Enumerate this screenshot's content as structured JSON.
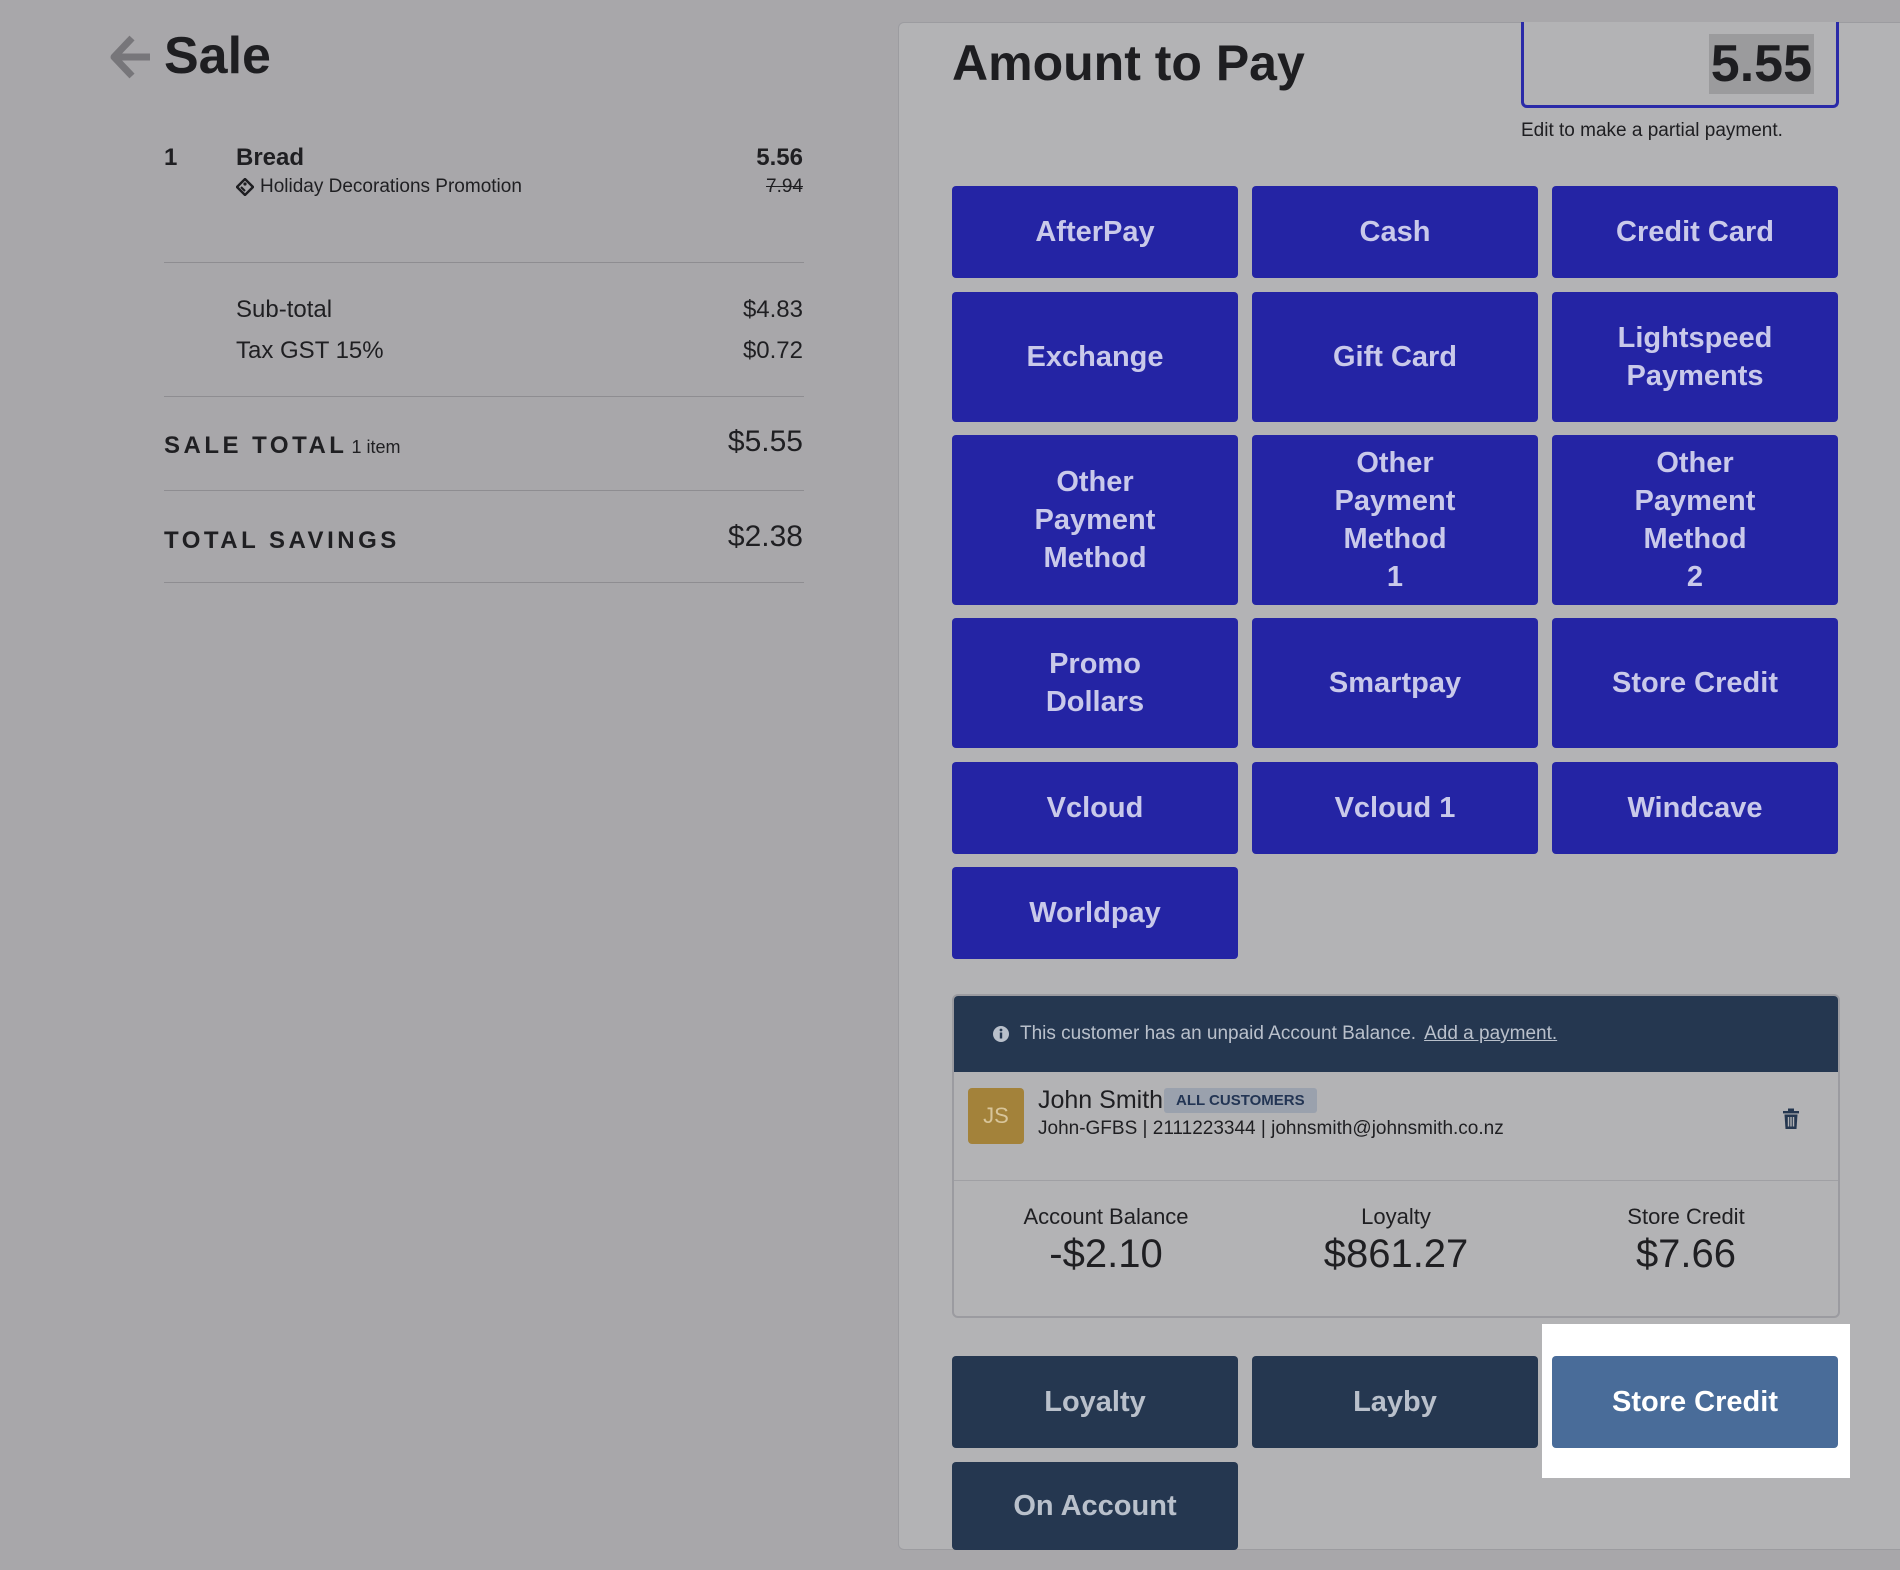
{
  "sale": {
    "title": "Sale",
    "item": {
      "qty": "1",
      "name": "Bread",
      "promo": "Holiday Decorations Promotion",
      "price": "5.56",
      "original_price": "7.94"
    },
    "subtotal_label": "Sub-total",
    "subtotal_value": "$4.83",
    "tax_label": "Tax GST 15%",
    "tax_value": "$0.72",
    "total_label": "SALE TOTAL",
    "total_items": "1 item",
    "total_value": "$5.55",
    "savings_label": "TOTAL SAVINGS",
    "savings_value": "$2.38"
  },
  "payment": {
    "title": "Amount to Pay",
    "amount": "5.55",
    "hint": "Edit to make a partial payment.",
    "methods": [
      "AfterPay",
      "Cash",
      "Credit Card",
      "Exchange",
      "Gift Card",
      "Lightspeed Payments",
      "Other Payment Method",
      "Other Payment Method 1",
      "Other Payment Method 2",
      "Promo Dollars",
      "Smartpay",
      "Store Credit",
      "Vcloud",
      "Vcloud 1",
      "Windcave",
      "Worldpay"
    ]
  },
  "customer": {
    "banner_text": "This customer has an unpaid Account Balance.",
    "banner_link": "Add a payment.",
    "initials": "JS",
    "name": "John Smith",
    "group": "ALL CUSTOMERS",
    "details": "John-GFBS | 2111223344 | johnsmith@johnsmith.co.nz",
    "account_balance_label": "Account Balance",
    "account_balance_value": "-$2.10",
    "loyalty_label": "Loyalty",
    "loyalty_value": "$861.27",
    "store_credit_label": "Store Credit",
    "store_credit_value": "$7.66"
  },
  "account_actions": {
    "loyalty": "Loyalty",
    "layby": "Layby",
    "store_credit": "Store Credit",
    "on_account": "On Account",
    "active": "Store Credit"
  },
  "icons": {
    "back": "arrow-left-icon",
    "promo": "tag-icon",
    "info": "info-icon",
    "delete": "trash-icon"
  },
  "colors": {
    "payment_button": "#2424a4",
    "account_button": "#253750",
    "active_button": "#496c99",
    "avatar": "#a3823a"
  }
}
